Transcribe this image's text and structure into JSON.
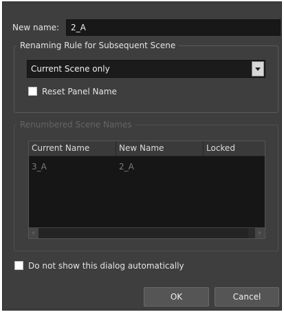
{
  "new_name": {
    "label": "New name:",
    "value": "2_A"
  },
  "renaming_rule": {
    "title": "Renaming Rule for Subsequent Scene",
    "dropdown_value": "Current Scene only",
    "reset_panel_label": "Reset Panel Name",
    "reset_panel_checked": false
  },
  "renumbered": {
    "title": "Renumbered Scene Names",
    "columns": [
      "Current Name",
      "New Name",
      "Locked"
    ],
    "rows": [
      {
        "current": "3_A",
        "new": "2_A",
        "locked": ""
      }
    ]
  },
  "footer": {
    "dont_show_label": "Do not show this dialog automatically",
    "dont_show_checked": false,
    "ok_label": "OK",
    "cancel_label": "Cancel"
  },
  "colors": {
    "dialog_bg": "#3e3e3e",
    "field_bg": "#181818",
    "button_bg": "#555555"
  }
}
